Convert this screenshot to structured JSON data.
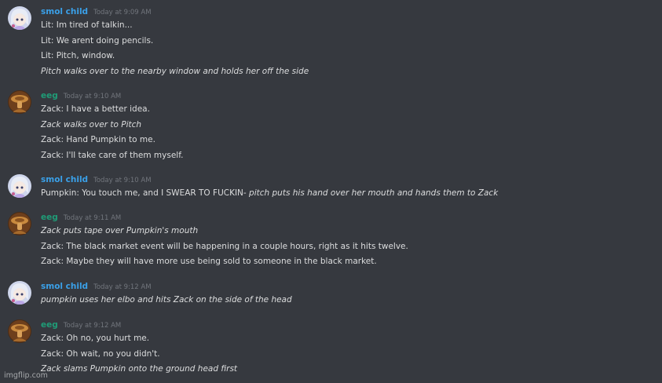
{
  "watermark": "imgflip.com",
  "colors": {
    "smol": "#3aa0e8",
    "eeg": "#1f9c77",
    "background": "#36393f",
    "text": "#dcddde",
    "timestamp": "#72767d"
  },
  "messages": [
    {
      "username": "smol child",
      "timestamp": "Today at 9:09 AM",
      "avatar": "anime-character-avatar",
      "lines": [
        {
          "text": "Lit: Im tired of talkin..."
        },
        {
          "text": "Lit: We arent doing pencils."
        },
        {
          "text": "Lit: Pitch, window."
        },
        {
          "text": "",
          "italic": "Pitch walks over to the nearby window and holds her off the side"
        }
      ]
    },
    {
      "username": "eeg",
      "timestamp": "Today at 9:10 AM",
      "avatar": "brown-figure-avatar",
      "lines": [
        {
          "text": "Zack: I have a better idea."
        },
        {
          "text": "",
          "italic": "Zack walks over to Pitch"
        },
        {
          "text": "Zack: Hand Pumpkin to me."
        },
        {
          "text": "Zack: I'll take care of them myself."
        }
      ]
    },
    {
      "username": "smol child",
      "timestamp": "Today at 9:10 AM",
      "avatar": "anime-character-avatar",
      "lines": [
        {
          "text": "Pumpkin: You touch me, and I SWEAR TO FUCKIN- ",
          "italic": "pitch puts his hand over her mouth and hands them to Zack"
        }
      ]
    },
    {
      "username": "eeg",
      "timestamp": "Today at 9:11 AM",
      "avatar": "brown-figure-avatar",
      "lines": [
        {
          "text": "",
          "italic": "Zack puts tape over Pumpkin's mouth"
        },
        {
          "text": "Zack: The black market event will be happening in a couple hours, right as it hits twelve."
        },
        {
          "text": "Zack: Maybe they will have more use being sold to someone in the black market."
        }
      ]
    },
    {
      "username": "smol child",
      "timestamp": "Today at 9:12 AM",
      "avatar": "anime-character-avatar",
      "lines": [
        {
          "text": "",
          "italic": "pumpkin uses her elbo and hits Zack on the side of the head"
        }
      ]
    },
    {
      "username": "eeg",
      "timestamp": "Today at 9:12 AM",
      "avatar": "brown-figure-avatar",
      "lines": [
        {
          "text": "Zack: Oh no, you hurt me."
        },
        {
          "text": "Zack: Oh wait, no you didn't."
        },
        {
          "text": "",
          "italic": "Zack slams Pumpkin onto the ground head first"
        }
      ]
    }
  ]
}
